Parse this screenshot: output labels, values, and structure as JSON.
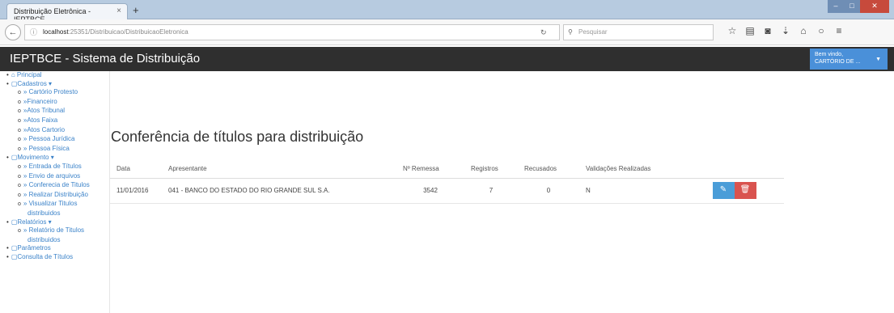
{
  "browser": {
    "tab_title": "Distribuição Eletrônica - IEPTBCE",
    "tab_close": "×",
    "new_tab": "+",
    "url_host": "localhost",
    "url_rest": ":25351/Distribuicao/DistribuicaoEletronica",
    "search_placeholder": "Pesquisar",
    "icons": [
      "star-icon",
      "bookmark-list-icon",
      "pocket-icon",
      "download-icon",
      "home-icon",
      "chat-icon",
      "menu-icon"
    ]
  },
  "header": {
    "title": "IEPTBCE - Sistema de Distribuição",
    "user_line1": "Bem vindo,",
    "user_line2": "CARTÓRIO DE ...",
    "accent": "#4a90d9"
  },
  "sidebar": {
    "principal": "Principal",
    "cadastros": "Cadastros ▾",
    "cadastros_items": [
      "» Cartório Protesto",
      "»Financeiro",
      "»Atos Tribunal",
      "»Atos Faixa",
      "»Atos Cartorio",
      "» Pessoa Jurídica",
      "» Pessoa Física"
    ],
    "movimento": "Movimento ▾",
    "movimento_items": [
      "» Entrada de Títulos",
      "» Envio de arquivos",
      "» Conferecia de Titulos",
      "» Realizar Distribuição",
      "» Visualizar Titulos"
    ],
    "movimento_wrap": "distribuidos",
    "relatorios": "Relatórios ▾",
    "relatorios_item": "» Relatório de Titulos",
    "relatorios_wrap": "distribuidos",
    "parametros": "Parâmetros",
    "consulta": "Consulta de Títulos"
  },
  "main": {
    "title": "Conferência de títulos para distribuição",
    "columns": [
      "Data",
      "Apresentante",
      "Nº Remessa",
      "Registros",
      "Recusados",
      "Validações Realizadas"
    ],
    "rows": [
      {
        "data": "11/01/2016",
        "apresentante": "041 - BANCO DO ESTADO DO RIO GRANDE SUL S.A.",
        "remessa": "3542",
        "registros": "7",
        "recusados": "0",
        "validacoes": "N"
      }
    ]
  }
}
